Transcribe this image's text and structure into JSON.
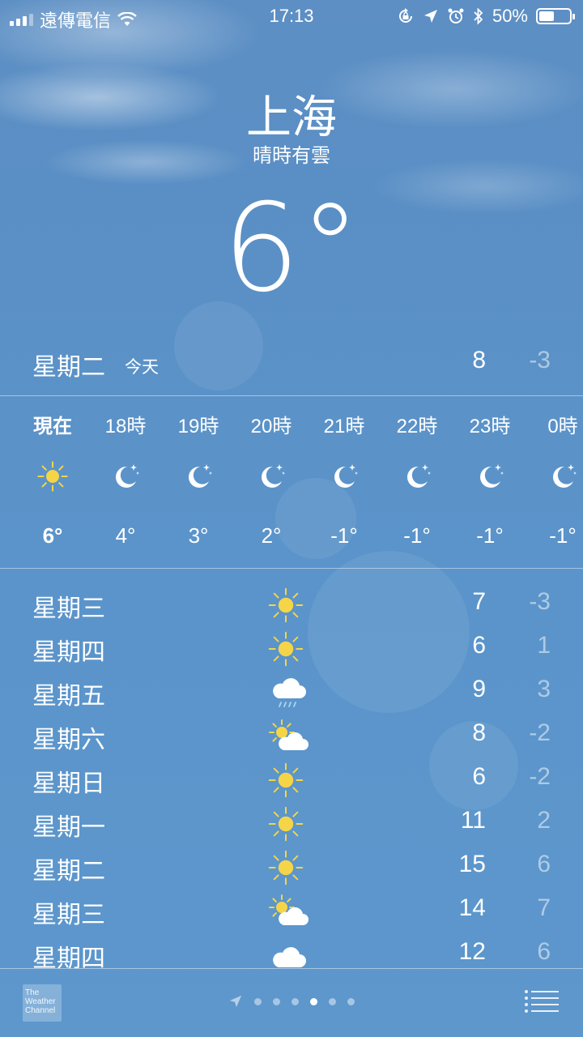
{
  "status_bar": {
    "carrier": "遠傳電信",
    "time": "17:13",
    "battery": "50%",
    "battery_level": 0.5,
    "icons": [
      "signal-icon",
      "wifi-icon",
      "rotation-lock-icon",
      "location-arrow-icon",
      "alarm-icon",
      "bluetooth-icon",
      "battery-icon"
    ]
  },
  "location": {
    "city": "上海",
    "condition": "晴時有雲",
    "temperature": "6°"
  },
  "today": {
    "day": "星期二",
    "tag": "今天",
    "high": "8",
    "low": "-3"
  },
  "hourly": [
    {
      "label": "現在",
      "icon": "sun-icon",
      "temp": "6°"
    },
    {
      "label": "18時",
      "icon": "moon-stars-icon",
      "temp": "4°"
    },
    {
      "label": "19時",
      "icon": "moon-stars-icon",
      "temp": "3°"
    },
    {
      "label": "20時",
      "icon": "moon-stars-icon",
      "temp": "2°"
    },
    {
      "label": "21時",
      "icon": "moon-stars-icon",
      "temp": "-1°"
    },
    {
      "label": "22時",
      "icon": "moon-stars-icon",
      "temp": "-1°"
    },
    {
      "label": "23時",
      "icon": "moon-stars-icon",
      "temp": "-1°"
    },
    {
      "label": "0時",
      "icon": "moon-stars-icon",
      "temp": "-1°"
    }
  ],
  "daily": [
    {
      "day": "星期三",
      "icon": "sun-icon",
      "high": "7",
      "low": "-3"
    },
    {
      "day": "星期四",
      "icon": "sun-icon",
      "high": "6",
      "low": "1"
    },
    {
      "day": "星期五",
      "icon": "rain-cloud-icon",
      "high": "9",
      "low": "3"
    },
    {
      "day": "星期六",
      "icon": "partly-cloudy-icon",
      "high": "8",
      "low": "-2"
    },
    {
      "day": "星期日",
      "icon": "sun-icon",
      "high": "6",
      "low": "-2"
    },
    {
      "day": "星期一",
      "icon": "sun-icon",
      "high": "11",
      "low": "2"
    },
    {
      "day": "星期二",
      "icon": "sun-icon",
      "high": "15",
      "low": "6"
    },
    {
      "day": "星期三",
      "icon": "partly-cloudy-icon",
      "high": "14",
      "low": "7"
    },
    {
      "day": "星期四",
      "icon": "cloud-icon",
      "high": "12",
      "low": "6"
    }
  ],
  "footer": {
    "logo_text": "The Weather Channel",
    "page_count": 6,
    "active_page": 4
  },
  "colors": {
    "sun": "#f5d547",
    "text": "#ffffff",
    "muted_text": "rgba(255,255,255,0.5)"
  }
}
